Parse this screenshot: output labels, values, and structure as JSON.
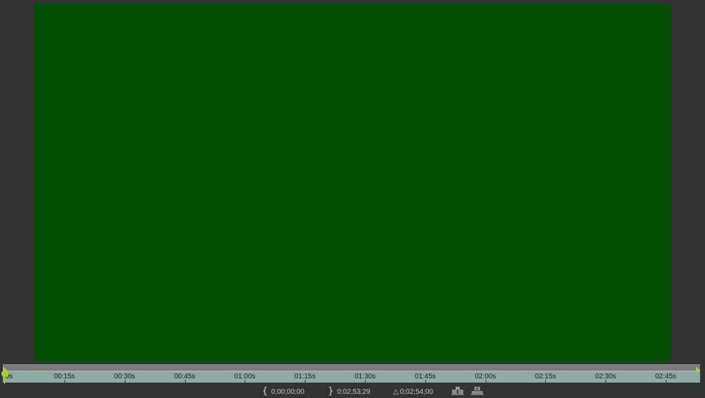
{
  "viewer": {
    "frame_color": "#054f05",
    "background_color": "#333333"
  },
  "timeline": {
    "ruler_color": "#8fa9a3",
    "handle_color": "#9bd629",
    "playhead_label": "0s",
    "ticks": [
      "00:15s",
      "00:30s",
      "00:45s",
      "01:00s",
      "01:15s",
      "01:30s",
      "01:45s",
      "02:00s",
      "02:15s",
      "02:30s",
      "02:45s"
    ]
  },
  "status": {
    "in_point": "0;00;00;00",
    "out_point": "0;02;53;29",
    "duration": "0;02;54;00",
    "delta_symbol": "△"
  },
  "icons": {
    "snapshot": "snapshot-icon",
    "show_snapshot": "show-snapshot-icon"
  }
}
